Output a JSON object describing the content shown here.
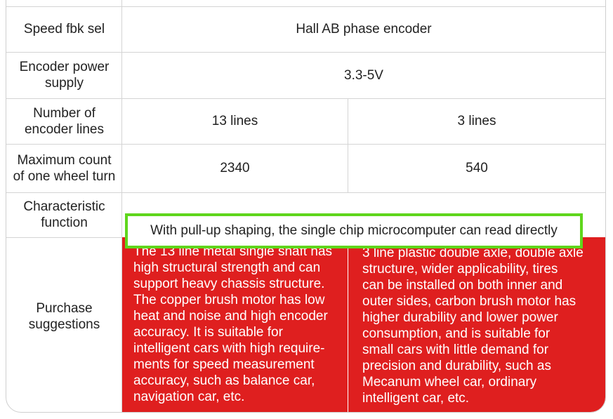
{
  "rows": {
    "speed_fbk": {
      "label": "Speed fbk sel",
      "value": "Hall AB phase encoder"
    },
    "encoder_power": {
      "label_lines": [
        "Encoder power",
        "supply"
      ],
      "value": "3.3-5V"
    },
    "encoder_lines": {
      "label_lines": [
        "Number of",
        "encoder lines"
      ],
      "col1": "13 lines",
      "col2": "3 lines"
    },
    "max_count": {
      "label_lines": [
        "Maximum count",
        "of one wheel turn"
      ],
      "col1": "2340",
      "col2": "540"
    },
    "characteristic": {
      "label_lines": [
        "Characteristic",
        "function"
      ],
      "value": "With pull-up shaping, the single chip microcomputer can read directly"
    },
    "purchase": {
      "label_lines": [
        "Purchase",
        "suggestions"
      ],
      "col1_lines": [
        "The 13 line metal single shaft has",
        "high structural strength and can",
        "support heavy chassis structure.",
        "The copper brush motor has low",
        "heat and noise and high encoder",
        "accuracy. It is suitable for",
        "intelligent cars with high require-",
        "ments for speed measurement",
        "accuracy, such as balance car,",
        "navigation car, etc."
      ],
      "col2_lines": [
        "3 line plastic double axle, double axle",
        "structure, wider applicability, tires",
        "can be installed on both inner and",
        "outer sides, carbon brush motor has",
        "higher durability and lower power",
        "consumption, and is suitable for",
        "small cars with little demand for",
        "precision and durability, such as",
        "Mecanum wheel car, ordinary",
        "intelligent car, etc."
      ]
    }
  },
  "colors": {
    "highlight_red": "#df1f1f",
    "highlight_green": "#5fd61c",
    "border": "#d4d4d4"
  }
}
